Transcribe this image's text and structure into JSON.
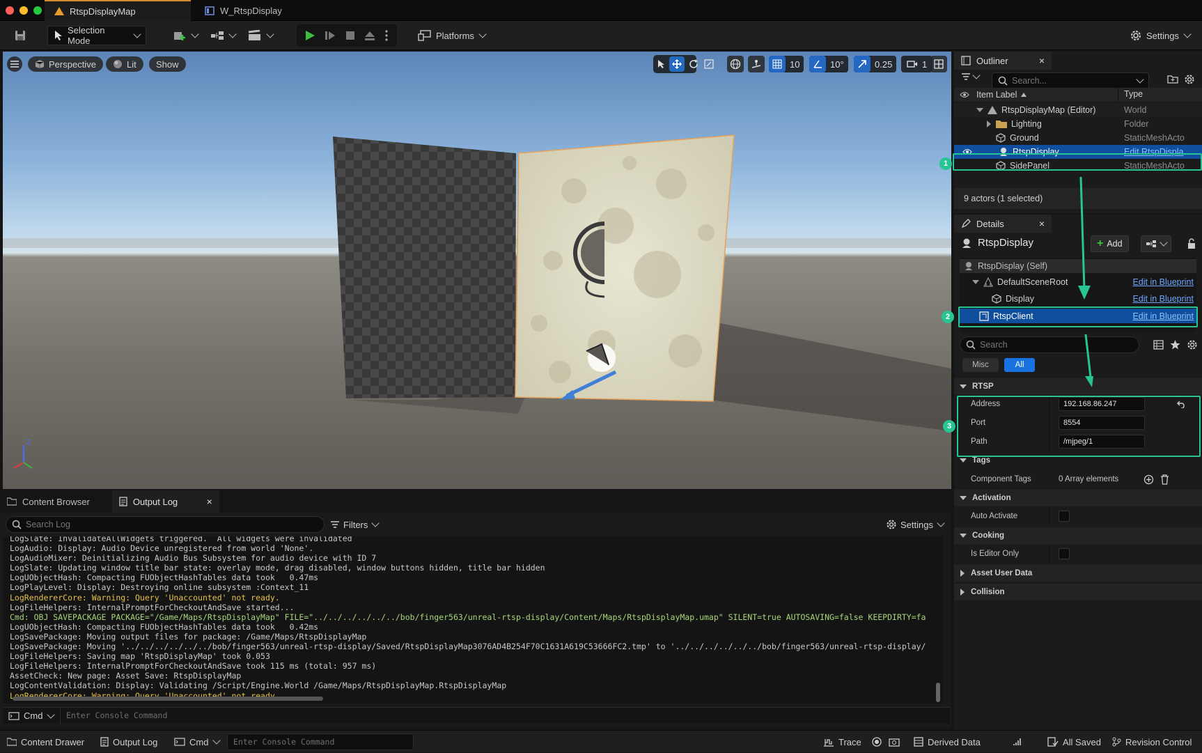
{
  "titlebar": {
    "tabs": [
      {
        "label": "RtspDisplayMap",
        "icon": "level-icon"
      },
      {
        "label": "W_RtspDisplay",
        "icon": "widget-blueprint-icon"
      }
    ]
  },
  "toolbar": {
    "selection_mode": "Selection Mode",
    "platforms": "Platforms",
    "settings": "Settings"
  },
  "viewport": {
    "perspective": "Perspective",
    "lit": "Lit",
    "show": "Show",
    "grid_snap": "10",
    "rotation_snap": "10°",
    "scale_snap": "0.25",
    "camera_speed": "1"
  },
  "outliner": {
    "title": "Outliner",
    "search_placeholder": "Search...",
    "col_label": "Item Label",
    "col_type": "Type",
    "rows": [
      {
        "label": "RtspDisplayMap (Editor)",
        "type": "World"
      },
      {
        "label": "Lighting",
        "type": "Folder"
      },
      {
        "label": "Ground",
        "type": "StaticMeshActo"
      },
      {
        "label": "RtspDisplay",
        "type": "Edit RtspDispla"
      },
      {
        "label": "SidePanel",
        "type": "StaticMeshActo"
      }
    ],
    "summary": "9 actors (1 selected)"
  },
  "details": {
    "title": "Details",
    "actor": "RtspDisplay",
    "add": "Add",
    "components": [
      {
        "label": "RtspDisplay (Self)",
        "link": ""
      },
      {
        "label": "DefaultSceneRoot",
        "link": "Edit in Blueprint"
      },
      {
        "label": "Display",
        "link": "Edit in Blueprint"
      },
      {
        "label": "RtspClient",
        "link": "Edit in Blueprint"
      }
    ],
    "search_placeholder": "Search",
    "filter_misc": "Misc",
    "filter_all": "All",
    "sections": {
      "rtsp": "RTSP",
      "tags": "Tags",
      "activation": "Activation",
      "cooking": "Cooking",
      "asset_user_data": "Asset User Data",
      "collision": "Collision"
    },
    "props": {
      "address_label": "Address",
      "address": "192.168.86.247",
      "port_label": "Port",
      "port": "8554",
      "path_label": "Path",
      "path": "/mjpeg/1",
      "component_tags_label": "Component Tags",
      "component_tags": "0 Array elements",
      "auto_activate_label": "Auto Activate",
      "editor_only_label": "Is Editor Only"
    }
  },
  "annotations": [
    "1",
    "2",
    "3"
  ],
  "bottom": {
    "tab_content": "Content Browser",
    "tab_output": "Output Log",
    "search_placeholder": "Search Log",
    "filters": "Filters",
    "settings": "Settings",
    "cmd": "Cmd",
    "console_placeholder": "Enter Console Command",
    "log_lines": [
      {
        "t": "LogSlate: InvalidateAllWidgets triggered.  All widgets were invalidated",
        "k": ""
      },
      {
        "t": "LogAudio: Display: Audio Device unregistered from world 'None'.",
        "k": ""
      },
      {
        "t": "LogAudioMixer: Deinitializing Audio Bus Subsystem for audio device with ID 7",
        "k": ""
      },
      {
        "t": "LogSlate: Updating window title bar state: overlay mode, drag disabled, window buttons hidden, title bar hidden",
        "k": ""
      },
      {
        "t": "LogUObjectHash: Compacting FUObjectHashTables data took   0.47ms",
        "k": ""
      },
      {
        "t": "LogPlayLevel: Display: Destroying online subsystem :Context_11",
        "k": ""
      },
      {
        "t": "LogRendererCore: Warning: Query 'Unaccounted' not ready.",
        "k": "w"
      },
      {
        "t": "LogFileHelpers: InternalPromptForCheckoutAndSave started...",
        "k": ""
      },
      {
        "t": "Cmd: OBJ SAVEPACKAGE PACKAGE=\"/Game/Maps/RtspDisplayMap\" FILE=\"../../../../../../bob/finger563/unreal-rtsp-display/Content/Maps/RtspDisplayMap.umap\" SILENT=true AUTOSAVING=false KEEPDIRTY=fa",
        "k": "c"
      },
      {
        "t": "LogUObjectHash: Compacting FUObjectHashTables data took   0.42ms",
        "k": ""
      },
      {
        "t": "LogSavePackage: Moving output files for package: /Game/Maps/RtspDisplayMap",
        "k": ""
      },
      {
        "t": "LogSavePackage: Moving '../../../../../../bob/finger563/unreal-rtsp-display/Saved/RtspDisplayMap3076AD4B254F70C1631A619C53666FC2.tmp' to '../../../../../../bob/finger563/unreal-rtsp-display/",
        "k": ""
      },
      {
        "t": "LogFileHelpers: Saving map 'RtspDisplayMap' took 0.053",
        "k": ""
      },
      {
        "t": "LogFileHelpers: InternalPromptForCheckoutAndSave took 115 ms (total: 957 ms)",
        "k": ""
      },
      {
        "t": "AssetCheck: New page: Asset Save: RtspDisplayMap",
        "k": ""
      },
      {
        "t": "LogContentValidation: Display: Validating /Script/Engine.World /Game/Maps/RtspDisplayMap.RtspDisplayMap",
        "k": ""
      },
      {
        "t": "LogRendererCore: Warning: Query 'Unaccounted' not ready.",
        "k": "w"
      }
    ]
  },
  "statusbar": {
    "content_drawer": "Content Drawer",
    "output_log": "Output Log",
    "cmd": "Cmd",
    "console_placeholder": "Enter Console Command",
    "trace": "Trace",
    "derived_data": "Derived Data",
    "all_saved": "All Saved",
    "revision_control": "Revision Control"
  }
}
